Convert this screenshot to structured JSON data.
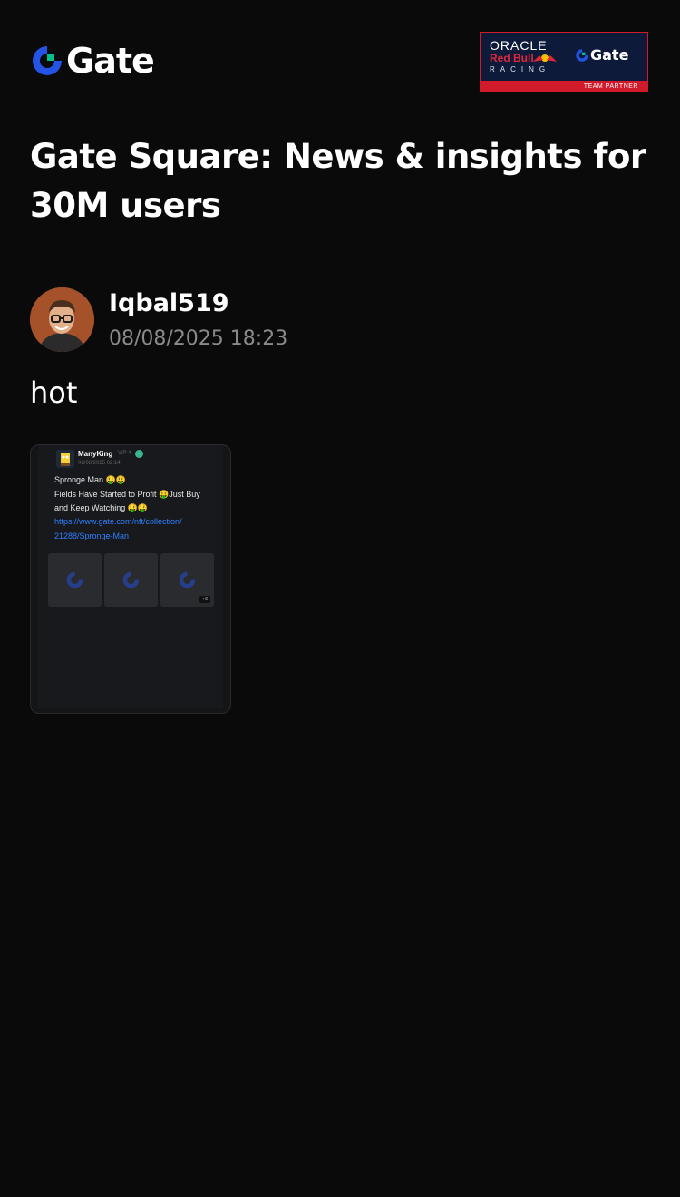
{
  "header": {
    "logo_text": "Gate",
    "brand_color": "#2354e6",
    "accent_color": "#00c08b",
    "partner_badge": {
      "oracle": "ORACLE",
      "redbull": "Red Bull",
      "racing": "RACING",
      "gate": "Gate",
      "strip": "TEAM PARTNER"
    }
  },
  "page": {
    "title": "Gate Square: News & insights for 30M users"
  },
  "post": {
    "author": "Iqbal519",
    "timestamp": "08/08/2025 18:23",
    "text": "hot",
    "embed": {
      "author": "ManyKing",
      "badge": "VIP 4",
      "timestamp": "08/08/2025 02:14",
      "lines": [
        "Spronge Man  🤑🤑",
        "Fields Have Started to Profit 🤑Just Buy",
        "and Keep Watching 🤑🤑"
      ],
      "link_lines": [
        "https://www.gate.com/nft/collection/",
        "21288/Spronge-Man"
      ],
      "more_count": "+6"
    }
  }
}
